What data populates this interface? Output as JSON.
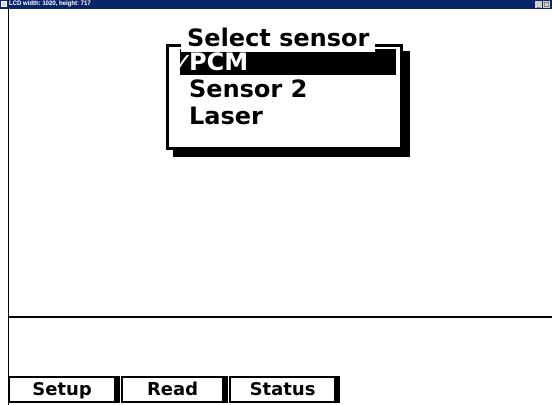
{
  "window": {
    "title": "LCD width: 1020, height: 717",
    "minimize": "_",
    "maximize": "□"
  },
  "dialog": {
    "title": "Select sensor",
    "items": [
      {
        "check": "✓",
        "label": "PCM",
        "selected": true
      },
      {
        "check": "",
        "label": "Sensor 2",
        "selected": false
      },
      {
        "check": "",
        "label": "Laser",
        "selected": false
      }
    ]
  },
  "softkeys": [
    {
      "label": "Setup"
    },
    {
      "label": "Read"
    },
    {
      "label": "Status"
    }
  ]
}
